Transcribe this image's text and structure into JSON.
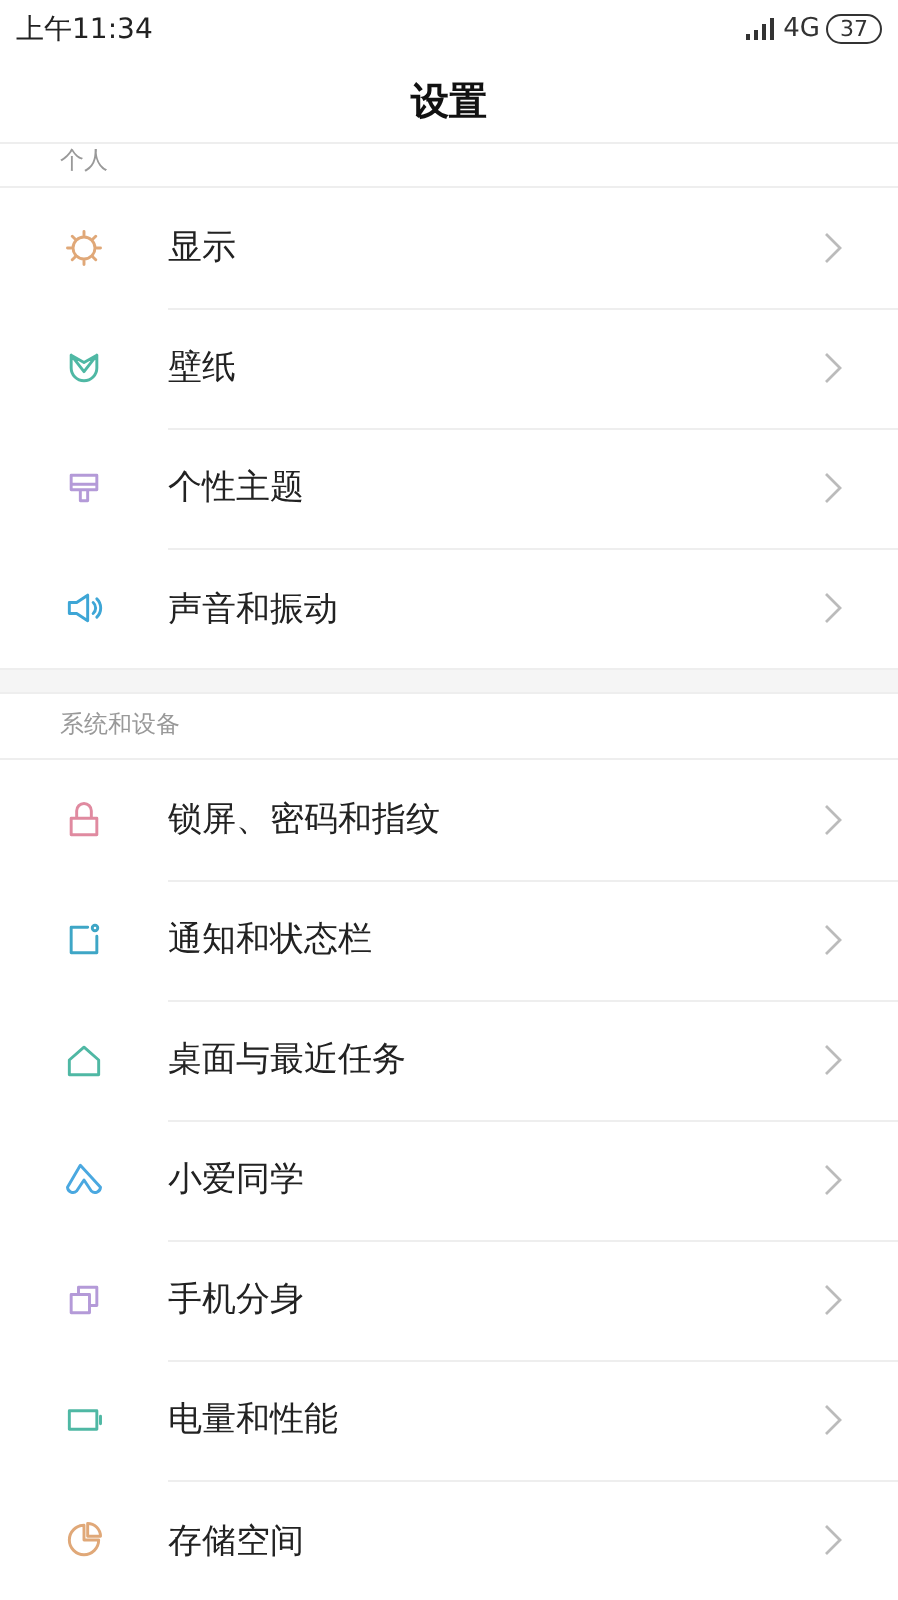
{
  "status_bar": {
    "time": "上午11:34",
    "network": "4G",
    "battery": "37"
  },
  "title": "设置",
  "sections": [
    {
      "header": "个人",
      "items": [
        {
          "label": "显示",
          "color": "#e0a878"
        },
        {
          "label": "壁纸",
          "color": "#4fb8a4"
        },
        {
          "label": "个性主题",
          "color": "#b49ad8"
        },
        {
          "label": "声音和振动",
          "color": "#3ea6d6"
        }
      ]
    },
    {
      "header": "系统和设备",
      "items": [
        {
          "label": "锁屏、密码和指纹",
          "color": "#e08aa0"
        },
        {
          "label": "通知和状态栏",
          "color": "#3ea6c6"
        },
        {
          "label": "桌面与最近任务",
          "color": "#4fb8a4"
        },
        {
          "label": "小爱同学",
          "color": "#4aa8e0"
        },
        {
          "label": "手机分身",
          "color": "#b49ad8"
        },
        {
          "label": "电量和性能",
          "color": "#4fb8a4"
        },
        {
          "label": "存储空间",
          "color": "#e0a878"
        }
      ]
    }
  ]
}
